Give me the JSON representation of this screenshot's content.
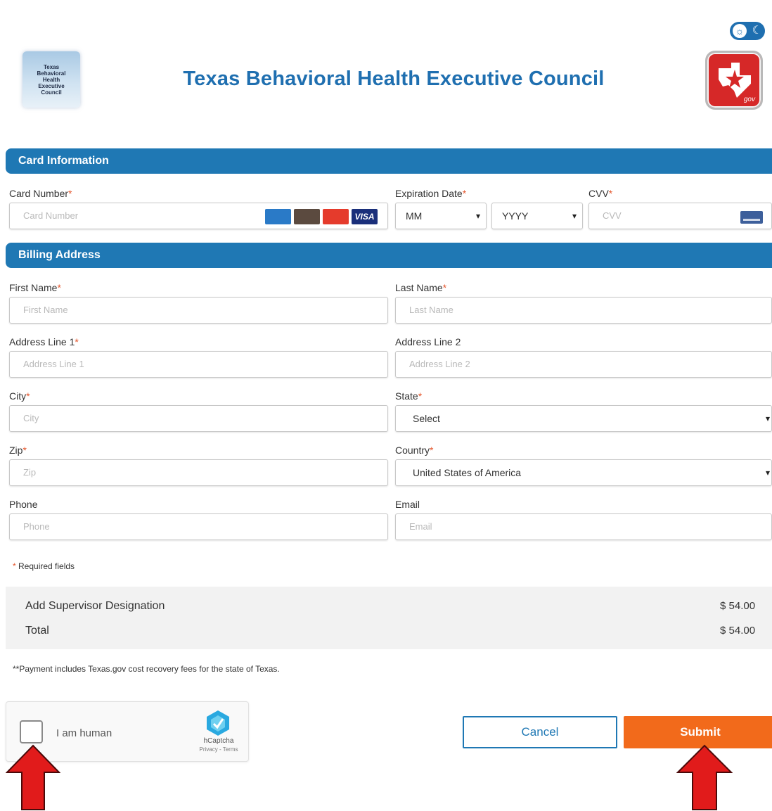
{
  "header": {
    "title": "Texas Behavioral Health Executive Council",
    "council_logo_text": "Texas Behavioral Health Executive Council",
    "texasgov_logo_text": "gov"
  },
  "sections": {
    "card": "Card Information",
    "billing": "Billing Address"
  },
  "card": {
    "number_label": "Card Number",
    "number_placeholder": "Card Number",
    "expiration_label": "Expiration Date",
    "month_value": "MM",
    "year_value": "YYYY",
    "cvv_label": "CVV",
    "cvv_placeholder": "CVV",
    "brand_logos": [
      "amex",
      "discover",
      "mastercard",
      "VISA"
    ]
  },
  "billing": {
    "first_name_label": "First Name",
    "first_name_placeholder": "First Name",
    "last_name_label": "Last Name",
    "last_name_placeholder": "Last Name",
    "address1_label": "Address Line 1",
    "address1_placeholder": "Address Line 1",
    "address2_label": "Address Line 2",
    "address2_placeholder": "Address Line 2",
    "city_label": "City",
    "city_placeholder": "City",
    "state_label": "State",
    "state_value": "Select",
    "zip_label": "Zip",
    "zip_placeholder": "Zip",
    "country_label": "Country",
    "country_value": "United States of America",
    "phone_label": "Phone",
    "phone_placeholder": "Phone",
    "email_label": "Email",
    "email_placeholder": "Email"
  },
  "required_mark": "*",
  "required_note": "Required fields",
  "summary": {
    "item_label": "Add Supervisor Designation",
    "item_amount": "$ 54.00",
    "total_label": "Total",
    "total_amount": "$ 54.00"
  },
  "fees_note": "**Payment includes Texas.gov cost recovery fees for the state of Texas.",
  "captcha": {
    "label": "I am human",
    "brand": "hCaptcha",
    "links": "Privacy - Terms"
  },
  "buttons": {
    "cancel": "Cancel",
    "submit": "Submit"
  },
  "colors": {
    "primary": "#1f78b4",
    "submit": "#f26a1b",
    "required": "#e4572e",
    "annotation_arrow": "#e11b1b"
  }
}
